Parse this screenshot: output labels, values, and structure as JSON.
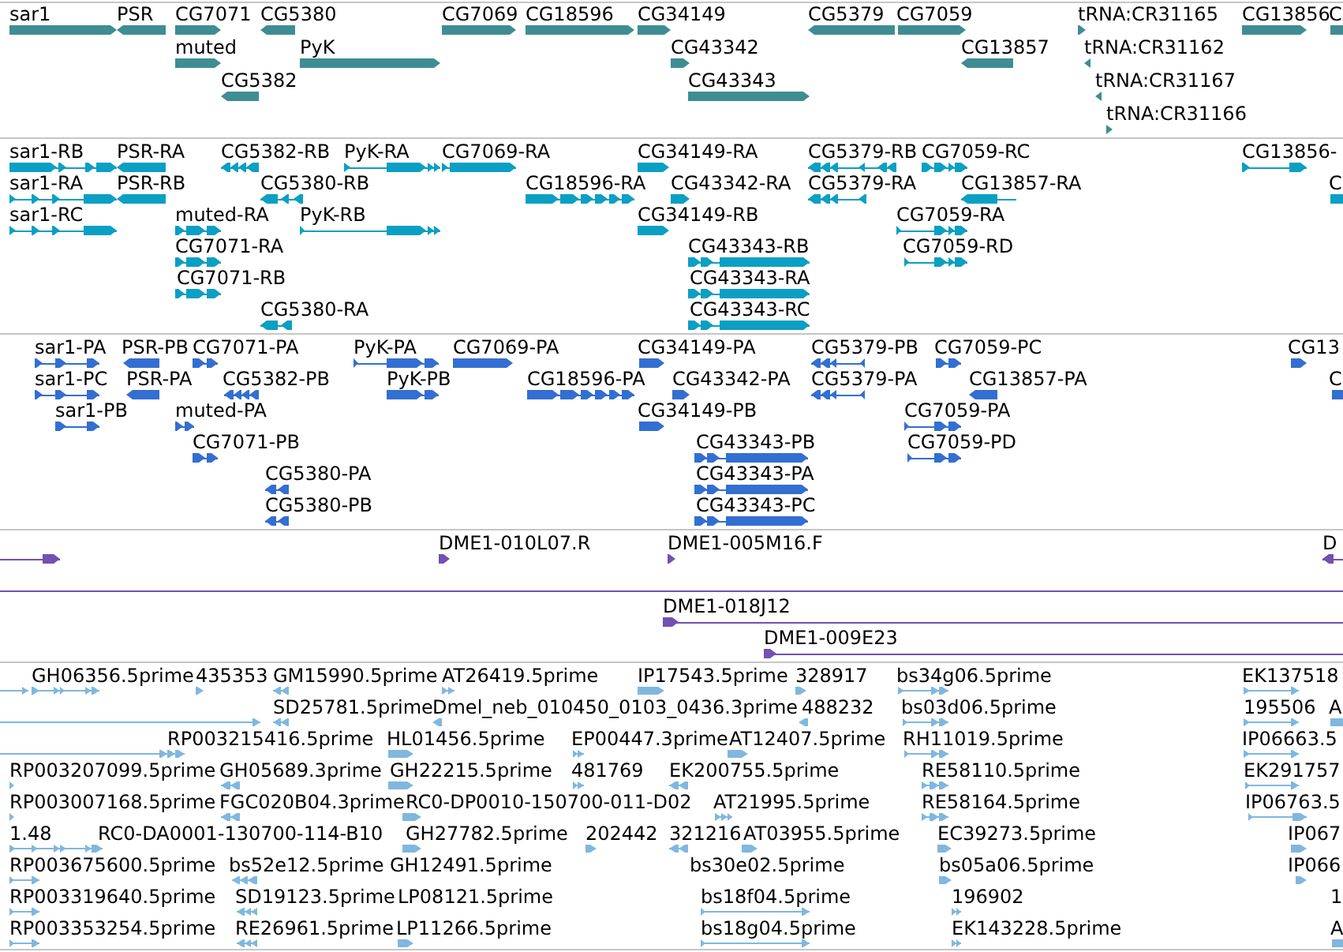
{
  "tracks": [
    {
      "kind": "gene",
      "color": "#3e8d93",
      "rows": [
        {
          "features": [
            {
              "label": "sar1",
              "reverse": false,
              "selected": false
            },
            {
              "label": "PSR",
              "reverse": true,
              "selected": false
            },
            {
              "label": "CG7071",
              "reverse": false,
              "selected": false
            },
            {
              "label": "CG5380",
              "reverse": true,
              "selected": false
            },
            {
              "label": "CG7069",
              "reverse": false,
              "selected": false
            },
            {
              "label": "CG18596",
              "reverse": false,
              "selected": false
            },
            {
              "label": "CG34149",
              "reverse": false,
              "selected": false
            },
            {
              "label": "CG5379",
              "reverse": true,
              "selected": false
            },
            {
              "label": "CG7059",
              "reverse": false,
              "selected": false
            },
            {
              "label": "tRNA:CR31165",
              "reverse": false,
              "selected": false
            },
            {
              "label": "CG13856",
              "reverse": false,
              "selected": false
            },
            {
              "label": "C",
              "selected": false
            }
          ]
        },
        {
          "features": [
            {
              "label": "muted",
              "reverse": false,
              "selected": false
            },
            {
              "label": "PyK",
              "reverse": false,
              "selected": false
            },
            {
              "label": "CG43342",
              "reverse": false,
              "selected": false
            },
            {
              "label": "CG13857",
              "reverse": true,
              "selected": false
            },
            {
              "label": "tRNA:CR31162",
              "reverse": true,
              "selected": false
            }
          ]
        },
        {
          "features": [
            {
              "label": "CG5382",
              "reverse": true,
              "selected": false
            },
            {
              "label": "CG43343",
              "reverse": false,
              "selected": false
            },
            {
              "label": "tRNA:CR31167",
              "reverse": true,
              "selected": false
            }
          ]
        },
        {
          "features": [
            {
              "label": "tRNA:CR31166",
              "reverse": false,
              "selected": false
            }
          ]
        }
      ]
    },
    {
      "kind": "transcript",
      "color": "#0b9fc4",
      "rows": [
        {
          "features": [
            {
              "label": "sar1-RB",
              "reverse": false,
              "selected": false
            },
            {
              "label": "PSR-RA",
              "reverse": true,
              "selected": false
            },
            {
              "label": "CG5382-RB",
              "reverse": true,
              "selected": false
            },
            {
              "label": "PyK-RA",
              "reverse": false,
              "selected": false
            },
            {
              "label": "CG7069-RA",
              "reverse": false,
              "selected": false
            },
            {
              "label": "CG34149-RA",
              "reverse": false,
              "selected": false
            },
            {
              "label": "CG5379-RB",
              "reverse": true,
              "selected": false
            },
            {
              "label": "CG7059-RC",
              "reverse": false,
              "selected": false
            },
            {
              "label": "CG13856-",
              "reverse": false,
              "selected": false
            }
          ]
        },
        {
          "features": [
            {
              "label": "sar1-RA",
              "reverse": false,
              "selected": false
            },
            {
              "label": "PSR-RB",
              "reverse": true,
              "selected": false
            },
            {
              "label": "CG5380-RB",
              "reverse": true,
              "selected": false
            },
            {
              "label": "CG18596-RA",
              "reverse": false,
              "selected": false
            },
            {
              "label": "CG43342-RA",
              "reverse": false,
              "selected": false
            },
            {
              "label": "CG5379-RA",
              "reverse": true,
              "selected": false
            },
            {
              "label": "CG13857-RA",
              "reverse": true,
              "selected": false
            },
            {
              "label": "C",
              "selected": false
            }
          ]
        },
        {
          "features": [
            {
              "label": "sar1-RC",
              "reverse": false,
              "selected": false
            },
            {
              "label": "muted-RA",
              "reverse": false,
              "selected": false
            },
            {
              "label": "PyK-RB",
              "reverse": false,
              "selected": false
            },
            {
              "label": "CG34149-RB",
              "reverse": false,
              "selected": false
            },
            {
              "label": "CG7059-RA",
              "reverse": false,
              "selected": false
            }
          ]
        },
        {
          "features": [
            {
              "label": "CG7071-RA",
              "reverse": false,
              "selected": false
            },
            {
              "label": "CG43343-RB",
              "reverse": false,
              "selected": false
            },
            {
              "label": "CG7059-RD",
              "reverse": false,
              "selected": false
            }
          ]
        },
        {
          "features": [
            {
              "label": "CG7071-RB",
              "reverse": false,
              "selected": false
            },
            {
              "label": "CG43343-RA",
              "reverse": false,
              "selected": false
            }
          ]
        },
        {
          "features": [
            {
              "label": "CG5380-RA",
              "reverse": true,
              "selected": false
            },
            {
              "label": "CG43343-RC",
              "reverse": false,
              "selected": false
            }
          ]
        }
      ]
    },
    {
      "kind": "protein",
      "color": "#326fd1",
      "rows": [
        {
          "features": [
            {
              "label": "sar1-PA",
              "reverse": false,
              "selected": false
            },
            {
              "label": "PSR-PB",
              "reverse": true,
              "selected": false
            },
            {
              "label": "CG7071-PA",
              "reverse": false,
              "selected": false
            },
            {
              "label": "PyK-PA",
              "reverse": false,
              "selected": false
            },
            {
              "label": "CG7069-PA",
              "reverse": false,
              "selected": false
            },
            {
              "label": "CG34149-PA",
              "reverse": false,
              "selected": false
            },
            {
              "label": "CG5379-PB",
              "reverse": true,
              "selected": false
            },
            {
              "label": "CG7059-PC",
              "reverse": false,
              "selected": false
            },
            {
              "label": "CG13",
              "reverse": false,
              "selected": false
            }
          ]
        },
        {
          "features": [
            {
              "label": "sar1-PC",
              "reverse": false,
              "selected": false
            },
            {
              "label": "PSR-PA",
              "reverse": true,
              "selected": false
            },
            {
              "label": "CG5382-PB",
              "reverse": true,
              "selected": false
            },
            {
              "label": "PyK-PB",
              "reverse": false,
              "selected": false
            },
            {
              "label": "CG18596-PA",
              "reverse": false,
              "selected": false
            },
            {
              "label": "CG43342-PA",
              "reverse": false,
              "selected": false
            },
            {
              "label": "CG5379-PA",
              "reverse": true,
              "selected": false
            },
            {
              "label": "CG13857-PA",
              "reverse": true,
              "selected": false
            },
            {
              "label": "C",
              "selected": false
            }
          ]
        },
        {
          "features": [
            {
              "label": "sar1-PB",
              "reverse": false,
              "selected": false
            },
            {
              "label": "muted-PA",
              "reverse": false,
              "selected": false
            },
            {
              "label": "CG34149-PB",
              "reverse": false,
              "selected": false
            },
            {
              "label": "CG7059-PA",
              "reverse": false,
              "selected": false
            }
          ]
        },
        {
          "features": [
            {
              "label": "CG7071-PB",
              "reverse": false,
              "selected": false
            },
            {
              "label": "CG43343-PB",
              "reverse": false,
              "selected": false
            },
            {
              "label": "CG7059-PD",
              "reverse": false,
              "selected": false
            }
          ]
        },
        {
          "features": [
            {
              "label": "CG5380-PA",
              "reverse": true,
              "selected": false
            },
            {
              "label": "CG43343-PA",
              "reverse": false,
              "selected": false
            }
          ]
        },
        {
          "features": [
            {
              "label": "CG5380-PB",
              "reverse": true,
              "selected": false
            },
            {
              "label": "CG43343-PC",
              "reverse": false,
              "selected": false
            }
          ]
        }
      ]
    },
    {
      "kind": "clone",
      "color": "#7151b2",
      "rows": [
        {
          "features": [
            {
              "reverse": false,
              "selected": false
            },
            {
              "label": "DME1-010L07.R",
              "reverse": false,
              "selected": false
            },
            {
              "label": "DME1-005M16.F",
              "reverse": false,
              "selected": false
            },
            {
              "label": "D",
              "reverse": true,
              "selected": false
            }
          ]
        },
        {
          "features": [
            {
              "selected": false
            }
          ]
        },
        {
          "features": [
            {
              "label": "DME1-018J12",
              "reverse": false,
              "selected": false
            }
          ]
        },
        {
          "features": [
            {
              "label": "DME1-009E23",
              "reverse": false,
              "selected": false
            }
          ]
        }
      ]
    },
    {
      "kind": "est",
      "color": "#80b7df",
      "rows": [
        {
          "features": [
            {
              "reverse": false,
              "selected": false
            },
            {
              "label": "GH06356.5prime",
              "reverse": false,
              "selected": false
            },
            {
              "label": "435353",
              "reverse": false,
              "selected": false
            },
            {
              "label": "GM15990.5prime",
              "reverse": true,
              "selected": false
            },
            {
              "label": "AT26419.5prime",
              "reverse": false,
              "selected": false
            },
            {
              "label": "IP17543.5prime",
              "reverse": false,
              "selected": false
            },
            {
              "label": "328917",
              "reverse": false,
              "selected": false
            },
            {
              "label": "bs34g06.5prime",
              "reverse": false,
              "selected": false
            },
            {
              "label": "EK137518",
              "reverse": false,
              "selected": false
            }
          ]
        },
        {
          "features": [
            {
              "reverse": false,
              "selected": false
            },
            {
              "label": "SD25781.5prime",
              "reverse": true,
              "selected": false
            },
            {
              "label": "Dmel_neb_010450_0103_0436.3prime",
              "reverse": true,
              "selected": false
            },
            {
              "label": "488232",
              "reverse": true,
              "selected": false
            },
            {
              "label": "bs03d06.5prime",
              "reverse": false,
              "selected": false
            },
            {
              "label": "195506",
              "reverse": false,
              "selected": false
            },
            {
              "label": "A",
              "selected": false
            }
          ]
        },
        {
          "features": [
            {
              "label": "RP003215416.5prime",
              "reverse": false,
              "selected": false
            },
            {
              "label": "HL01456.5prime",
              "reverse": false,
              "selected": false
            },
            {
              "label": "EP00447.3prime",
              "reverse": false,
              "selected": false
            },
            {
              "label": "AT12407.5prime",
              "reverse": false,
              "selected": false
            },
            {
              "label": "RH11019.5prime",
              "reverse": false,
              "selected": false
            },
            {
              "label": "IP06663.5",
              "reverse": false,
              "selected": false
            }
          ]
        },
        {
          "features": [
            {
              "label": "RP003207099.5prime",
              "reverse": false,
              "selected": false
            },
            {
              "label": "GH05689.3prime",
              "reverse": true,
              "selected": false
            },
            {
              "label": "GH22215.5prime",
              "reverse": false,
              "selected": false
            },
            {
              "label": "481769",
              "reverse": false,
              "selected": false
            },
            {
              "label": "EK200755.5prime",
              "reverse": true,
              "selected": false
            },
            {
              "label": "RE58110.5prime",
              "reverse": false,
              "selected": false
            },
            {
              "label": "EK291757",
              "reverse": false,
              "selected": false
            }
          ]
        },
        {
          "features": [
            {
              "label": "RP003007168.5prime",
              "reverse": false,
              "selected": false
            },
            {
              "label": "FGC020B04.3prime",
              "reverse": true,
              "selected": false
            },
            {
              "label": "RC0-DP0010-150700-011-D02",
              "reverse": false,
              "selected": false
            },
            {
              "label": "AT21995.5prime",
              "reverse": false,
              "selected": false
            },
            {
              "label": "RE58164.5prime",
              "reverse": false,
              "selected": false
            },
            {
              "label": "IP06763.5",
              "reverse": false,
              "selected": false
            }
          ]
        },
        {
          "features": [
            {
              "label": "1.48",
              "reverse": false,
              "selected": false
            },
            {
              "label": "RC0-DA0001-130700-114-B10",
              "selected": false
            },
            {
              "label": "GH27782.5prime",
              "reverse": false,
              "selected": false
            },
            {
              "label": "202442",
              "reverse": false,
              "selected": false
            },
            {
              "label": "321216",
              "reverse": true,
              "selected": false
            },
            {
              "label": "AT03955.5prime",
              "reverse": false,
              "selected": false
            },
            {
              "label": "EC39273.5prime",
              "reverse": false,
              "selected": false
            },
            {
              "label": "IP067",
              "reverse": false,
              "selected": false
            }
          ]
        },
        {
          "features": [
            {
              "label": "RP003675600.5prime",
              "reverse": false,
              "selected": false
            },
            {
              "label": "bs52e12.5prime",
              "reverse": true,
              "selected": false
            },
            {
              "label": "GH12491.5prime",
              "selected": false
            },
            {
              "label": "bs30e02.5prime",
              "selected": false
            },
            {
              "label": "bs05a06.5prime",
              "reverse": false,
              "selected": false
            },
            {
              "label": "IP066",
              "reverse": false,
              "selected": false
            }
          ]
        },
        {
          "features": [
            {
              "label": "RP003319640.5prime",
              "reverse": false,
              "selected": false
            },
            {
              "label": "SD19123.5prime",
              "reverse": true,
              "selected": false
            },
            {
              "label": "LP08121.5prime",
              "selected": false
            },
            {
              "label": "bs18f04.5prime",
              "reverse": false,
              "selected": false
            },
            {
              "label": "196902",
              "reverse": false,
              "selected": false
            },
            {
              "label": "1",
              "selected": false
            }
          ]
        },
        {
          "features": [
            {
              "label": "RP003353254.5prime",
              "reverse": false,
              "selected": false
            },
            {
              "label": "RE26961.5prime",
              "reverse": true,
              "selected": false
            },
            {
              "label": "LP11266.5prime",
              "reverse": false,
              "selected": false
            },
            {
              "label": "bs18g04.5prime",
              "reverse": false,
              "selected": false
            },
            {
              "label": "EK143228.5prime",
              "reverse": false,
              "selected": false
            },
            {
              "label": "A",
              "selected": false
            }
          ]
        }
      ]
    }
  ]
}
